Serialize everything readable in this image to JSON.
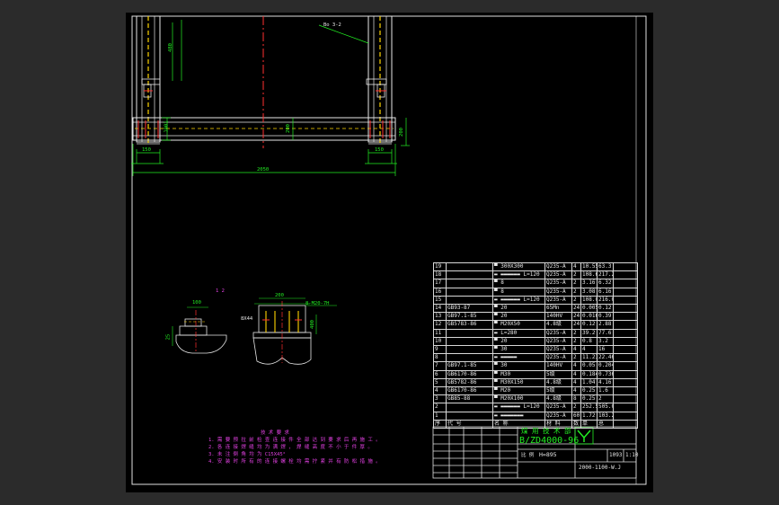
{
  "drawing": {
    "dimensions": {
      "overall_width": "2050",
      "left_bottom": "150",
      "right_bottom": "150",
      "height_a": "480",
      "height_b": "1001",
      "center": "200",
      "side_right": "200",
      "detail_top_left": "100",
      "detail_top_right": "200",
      "detail_left_side": "25",
      "detail_center": "400"
    },
    "callouts": {
      "top_leader": "Bo 3-2",
      "detail_label_left": "1 2",
      "detail_label_right": "8-M20-7H",
      "detail_hole": "8X44"
    }
  },
  "notes": {
    "title": "技 术 要 求",
    "lines": [
      "1. 需 要 预 拉 前 检 查 连 接 件 全 部 达 到 要 求 后 再 施 工 。",
      "2. 各 连 接 焊 缝 均 为 满 焊 ， 焊 缝 高 度 不 小 于 件 厚 。",
      "3. 未 注 倒 角 均 为 C15X45°",
      "4. 安 装 时 所 有 的 连 接 螺 栓 均 需 拧 紧 并 有 防 松 措 施 。"
    ]
  },
  "bom": {
    "rows": [
      {
        "no": "19",
        "std": "",
        "name": "▀ 300X300",
        "mat": "Q235-A",
        "qty": "4",
        "w1": "10.55",
        "w2": "63.3"
      },
      {
        "no": "18",
        "std": "",
        "name": "▬ ▬▬▬▬▬▬ L=120",
        "mat": "Q235-A",
        "qty": "2",
        "w1": "108.6",
        "w2": "217.2"
      },
      {
        "no": "17",
        "std": "",
        "name": "▀ 8",
        "mat": "Q235-A",
        "qty": "2",
        "w1": "3.16",
        "w2": "6.32"
      },
      {
        "no": "16",
        "std": "",
        "name": "▀ 8",
        "mat": "Q235-A",
        "qty": "2",
        "w1": "3.08",
        "w2": "6.16"
      },
      {
        "no": "15",
        "std": "",
        "name": "▬ ▬▬▬▬▬▬ L=120",
        "mat": "Q235-A",
        "qty": "2",
        "w1": "108.08",
        "w2": "216.04"
      },
      {
        "no": "14",
        "std": "GB93-87",
        "name": "▀ 20",
        "mat": "65Mn",
        "qty": "24",
        "w1": "0.005",
        "w2": "0.12"
      },
      {
        "no": "13",
        "std": "GB97.1-85",
        "name": "▀ 20",
        "mat": "140HV",
        "qty": "24",
        "w1": "0.016",
        "w2": "0.39"
      },
      {
        "no": "12",
        "std": "GB5783-86",
        "name": "▀ M20X50",
        "mat": "4.8级",
        "qty": "24",
        "w1": "0.12",
        "w2": "2.88"
      },
      {
        "no": "11",
        "std": "",
        "name": "▬ L=280",
        "mat": "Q235-A",
        "qty": "2",
        "w1": "39.2",
        "w2": "77.6"
      },
      {
        "no": "10",
        "std": "",
        "name": "▀ 20",
        "mat": "Q235-A",
        "qty": "2",
        "w1": "0.8",
        "w2": "3.2"
      },
      {
        "no": "9",
        "std": "",
        "name": "▀ 30",
        "mat": "Q235-A",
        "qty": "4",
        "w1": "4",
        "w2": "16"
      },
      {
        "no": "8",
        "std": "",
        "name": "▬ ▬▬▬▬▬",
        "mat": "Q235-A",
        "qty": "2",
        "w1": "11.23",
        "w2": "22.46"
      },
      {
        "no": "7",
        "std": "GB97.1-85",
        "name": "▀ 30",
        "mat": "140HV",
        "qty": "4",
        "w1": "0.05",
        "w2": "0.204"
      },
      {
        "no": "6",
        "std": "GB6170-86",
        "name": "▀ M30",
        "mat": "5级",
        "qty": "4",
        "w1": "0.184",
        "w2": "0.736"
      },
      {
        "no": "5",
        "std": "GB5782-86",
        "name": "▀ M30X150",
        "mat": "4.8级",
        "qty": "4",
        "w1": "1.04",
        "w2": "4.16"
      },
      {
        "no": "4",
        "std": "GB6170-86",
        "name": "▀ M20",
        "mat": "5级",
        "qty": "4",
        "w1": "0.25",
        "w2": "1.6"
      },
      {
        "no": "3",
        "std": "GB85-88",
        "name": "▀ M20X100",
        "mat": "4.8级",
        "qty": "8",
        "w1": "0.25",
        "w2": "2"
      },
      {
        "no": "2",
        "std": "",
        "name": "▬ ▬▬▬▬▬▬ L=120",
        "mat": "Q235-A",
        "qty": "2",
        "w1": "252.5",
        "w2": "505.00"
      },
      {
        "no": "1",
        "std": "",
        "name": "▬ ▬▬▬▬▬▬▬",
        "mat": "Q235-A",
        "qty": "60",
        "w1": "1.72",
        "w2": "103.2"
      }
    ],
    "header": {
      "no": "序",
      "std": "代 号",
      "name": "名 称",
      "mat": "材 料",
      "qty": "数",
      "w1": "单",
      "w2": "总"
    }
  },
  "title_block": {
    "company": "煤 用 技 术 部",
    "drawing_no": "B/ZD4000-96",
    "part_name": "H=895",
    "weight": "1093",
    "scale": "1:10",
    "footer": "2000-1100-W.J",
    "label_scale": "比 例"
  }
}
